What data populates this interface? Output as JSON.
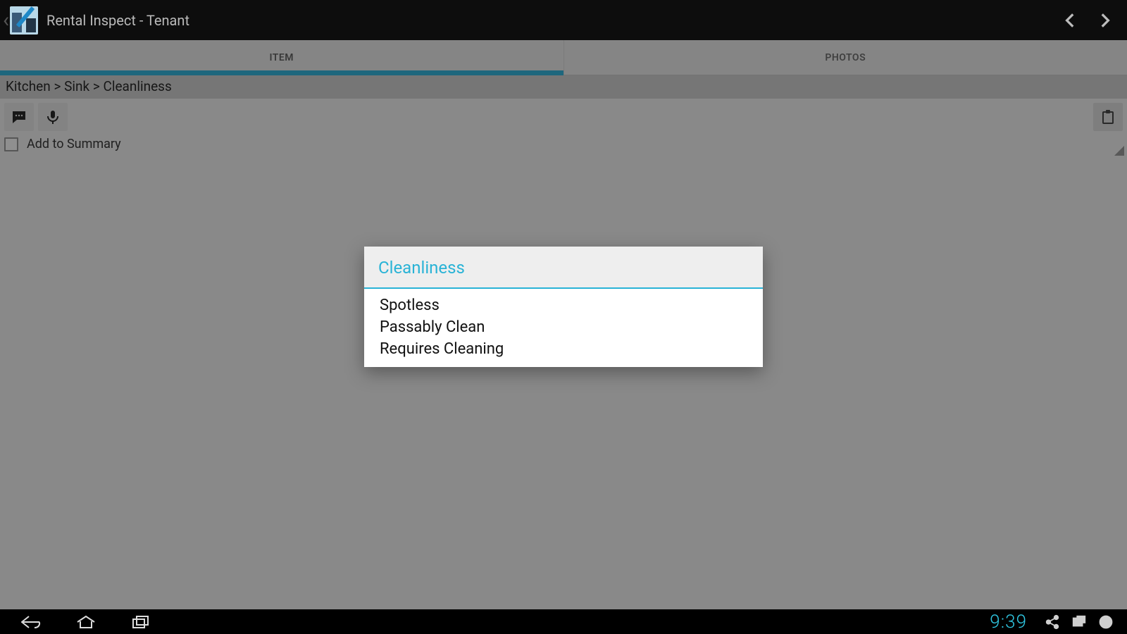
{
  "actionbar": {
    "title": "Rental Inspect - Tenant"
  },
  "tabs": {
    "item": "ITEM",
    "photos": "PHOTOS"
  },
  "breadcrumb": "Kitchen > Sink > Cleanliness",
  "summary": {
    "label": "Add to Summary"
  },
  "dialog": {
    "title": "Cleanliness",
    "options": [
      "Spotless",
      "Passably Clean",
      "Requires Cleaning"
    ]
  },
  "clock": "9:39"
}
